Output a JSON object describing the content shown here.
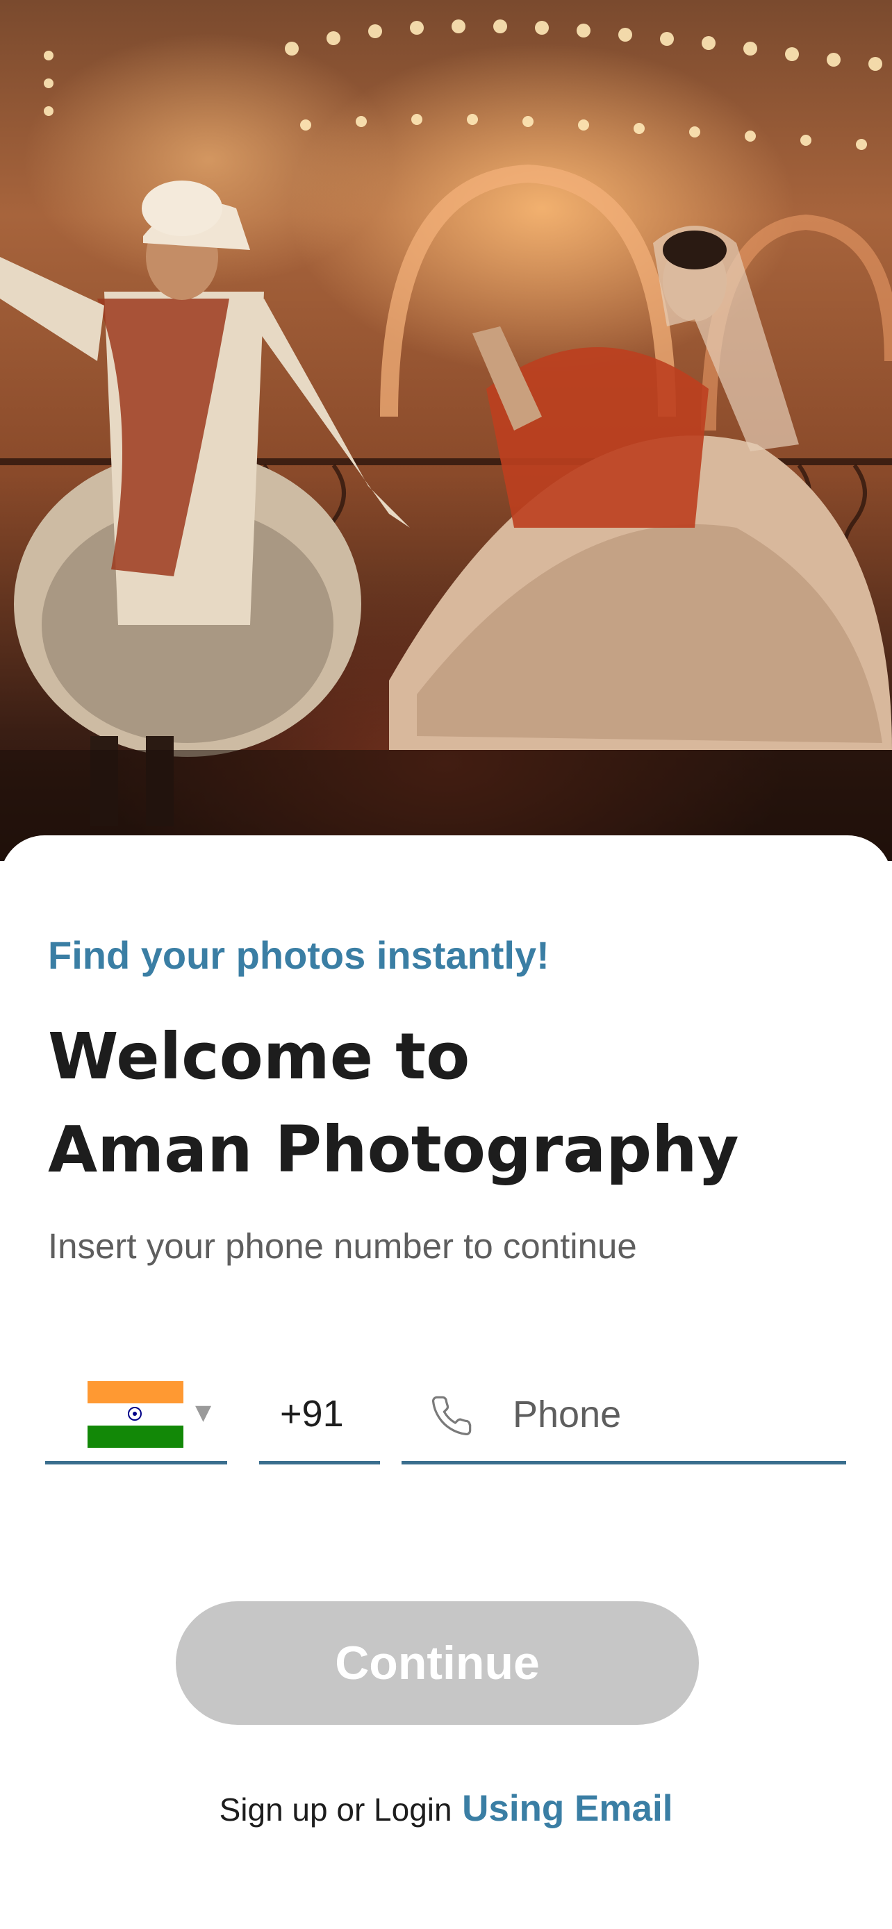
{
  "hero": {
    "image": "wedding-couple-photo"
  },
  "tagline": "Find your photos instantly!",
  "welcome": {
    "line1": "Welcome to",
    "line2": "Aman Photography"
  },
  "subtitle": "Insert your phone number to continue",
  "phone_form": {
    "country_flag": "india-flag",
    "country_code": "+91",
    "phone_placeholder": "Phone",
    "phone_value": ""
  },
  "continue_label": "Continue",
  "signup": {
    "prefix": "Sign up or Login",
    "link": "Using Email"
  },
  "colors": {
    "accent": "#3a7ea4",
    "button_disabled": "#c6c6c6",
    "heading": "#1d1d1d",
    "underline": "#3a6e8e"
  }
}
